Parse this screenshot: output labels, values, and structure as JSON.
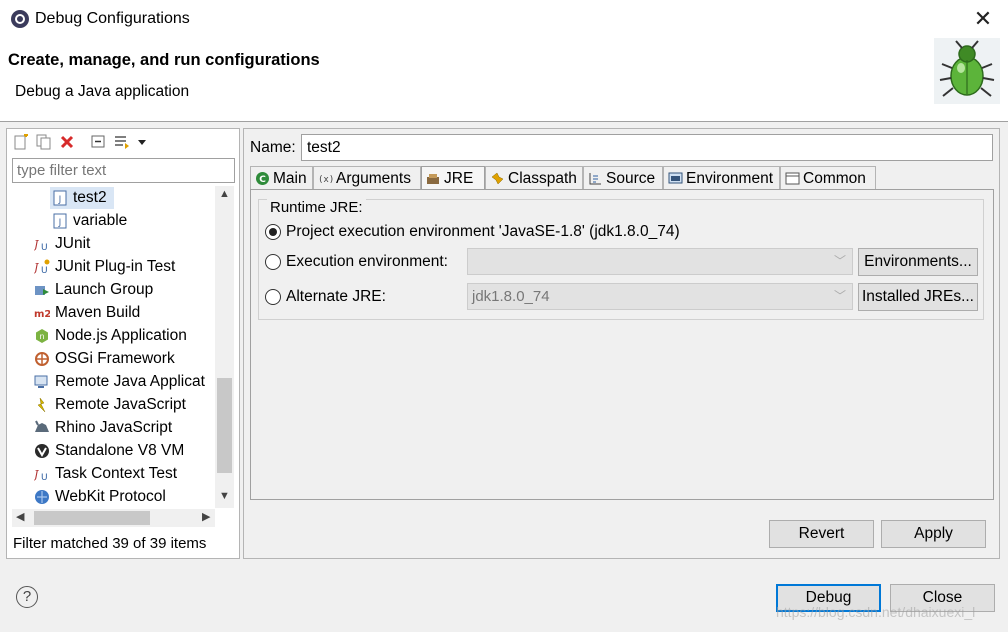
{
  "window": {
    "title": "Debug Configurations",
    "close_glyph": "✕"
  },
  "banner": {
    "title": "Create, manage, and run configurations",
    "subtitle": "Debug a Java application",
    "icon": "debug-bug-icon"
  },
  "left": {
    "toolbar_icons": [
      "new-configuration-icon",
      "duplicate-icon",
      "delete-icon",
      "collapse-all-icon",
      "filter-icon",
      "dropdown-arrow-icon"
    ],
    "filter_placeholder": "type filter text",
    "tree": [
      {
        "label": "test2",
        "icon": "java-file-icon",
        "indent": 1,
        "selected": true
      },
      {
        "label": "variable",
        "icon": "java-file-icon",
        "indent": 1,
        "selected": false
      },
      {
        "label": "JUnit",
        "icon": "junit-icon",
        "indent": 0,
        "selected": false
      },
      {
        "label": "JUnit Plug-in Test",
        "icon": "junit-plugin-icon",
        "indent": 0,
        "selected": false
      },
      {
        "label": "Launch Group",
        "icon": "launch-group-icon",
        "indent": 0,
        "selected": false
      },
      {
        "label": "Maven Build",
        "icon": "maven-icon",
        "indent": 0,
        "selected": false
      },
      {
        "label": "Node.js Application",
        "icon": "nodejs-icon",
        "indent": 0,
        "selected": false
      },
      {
        "label": "OSGi Framework",
        "icon": "osgi-icon",
        "indent": 0,
        "selected": false
      },
      {
        "label": "Remote Java Applicat",
        "icon": "remote-java-icon",
        "indent": 0,
        "selected": false
      },
      {
        "label": "Remote JavaScript",
        "icon": "remote-javascript-icon",
        "indent": 0,
        "selected": false
      },
      {
        "label": "Rhino JavaScript",
        "icon": "rhino-icon",
        "indent": 0,
        "selected": false
      },
      {
        "label": "Standalone V8 VM",
        "icon": "v8-icon",
        "indent": 0,
        "selected": false
      },
      {
        "label": "Task Context Test",
        "icon": "task-context-icon",
        "indent": 0,
        "selected": false
      },
      {
        "label": "WebKit Protocol",
        "icon": "webkit-icon",
        "indent": 0,
        "selected": false
      }
    ],
    "filter_status": "Filter matched 39 of 39 items"
  },
  "right": {
    "name_label": "Name:",
    "name_value": "test2",
    "tabs": [
      {
        "label": "Main",
        "icon": "main-tab-icon",
        "active": false
      },
      {
        "label": "Arguments",
        "icon": "arguments-tab-icon",
        "active": false
      },
      {
        "label": "JRE",
        "icon": "jre-tab-icon",
        "active": true
      },
      {
        "label": "Classpath",
        "icon": "classpath-tab-icon",
        "active": false
      },
      {
        "label": "Source",
        "icon": "source-tab-icon",
        "active": false
      },
      {
        "label": "Environment",
        "icon": "environment-tab-icon",
        "active": false
      },
      {
        "label": "Common",
        "icon": "common-tab-icon",
        "active": false
      }
    ],
    "jre": {
      "group_title": "Runtime JRE:",
      "option_project": "Project execution environment 'JavaSE-1.8' (jdk1.8.0_74)",
      "option_exec_env": "Execution environment:",
      "exec_env_value": "",
      "environments_button": "Environments...",
      "option_alternate": "Alternate JRE:",
      "alternate_value": "jdk1.8.0_74",
      "installed_jres_button": "Installed JREs...",
      "selected_option": "project"
    },
    "revert_button": "Revert",
    "apply_button": "Apply"
  },
  "footer": {
    "help_glyph": "?",
    "debug_button": "Debug",
    "close_button": "Close",
    "watermark": "https://blog.csdn.net/dhaixuexi_l"
  }
}
